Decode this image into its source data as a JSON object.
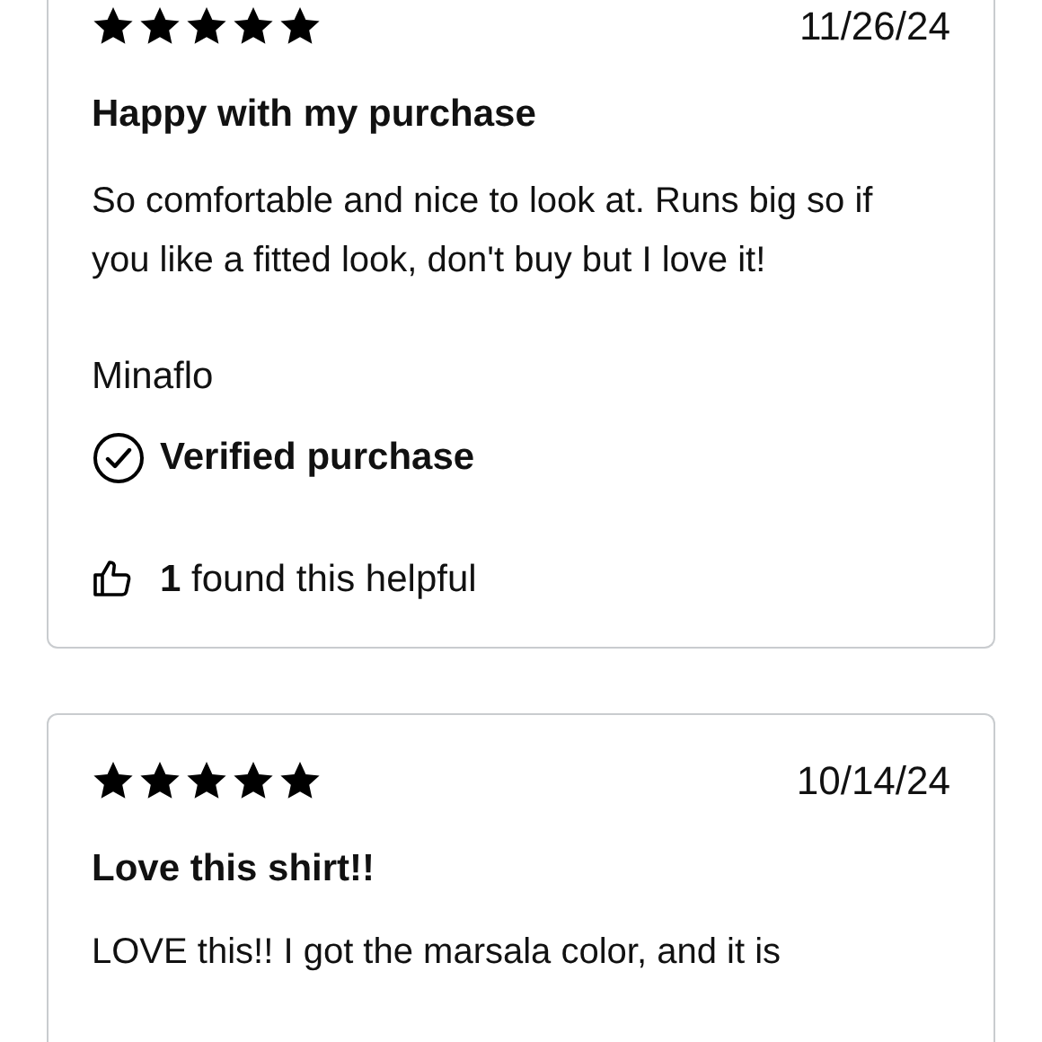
{
  "reviews": [
    {
      "stars": 5,
      "date": "11/26/24",
      "title": "Happy with my purchase",
      "body": "So comfortable and nice to look at. Runs big so if you like a fitted look, don't buy but I love it!",
      "author": "Minaflo",
      "verified": true,
      "verified_label": "Verified purchase",
      "helpful_count": "1",
      "helpful_text": "found this helpful"
    },
    {
      "stars": 5,
      "date": "10/14/24",
      "title": "Love this shirt!!",
      "body": "LOVE this!! I got the marsala color, and it is"
    }
  ]
}
